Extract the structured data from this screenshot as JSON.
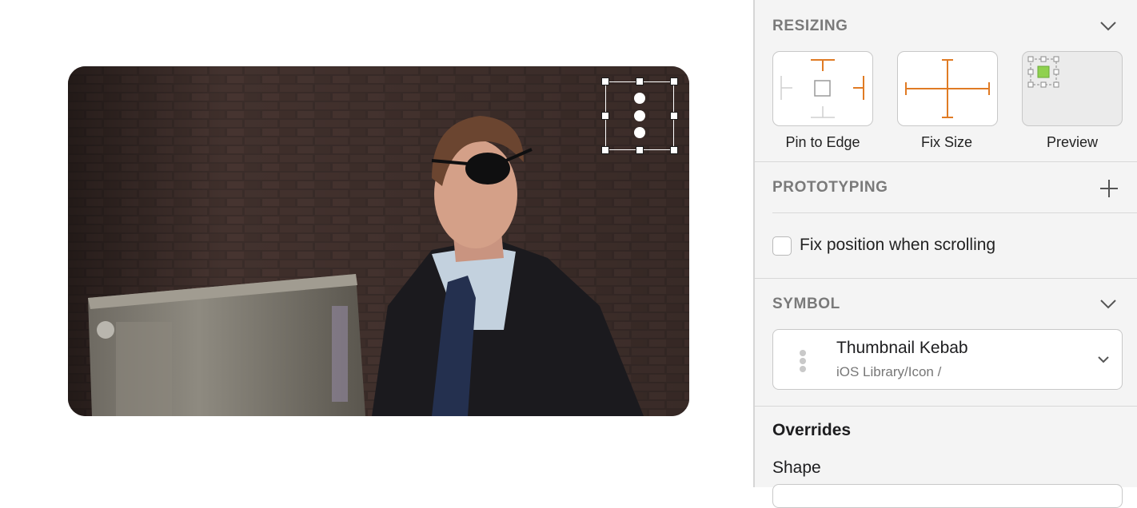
{
  "canvas": {
    "thumbnail": {
      "image_subject": "photo-man-with-eye-patch-in-alley"
    },
    "overlay_icon": "kebab-icon"
  },
  "inspector": {
    "resizing": {
      "title": "RESIZING",
      "options": [
        {
          "label": "Pin to Edge",
          "icon": "pin-to-edge-icon"
        },
        {
          "label": "Fix Size",
          "icon": "fix-size-icon"
        },
        {
          "label": "Preview",
          "icon": "preview-icon"
        }
      ]
    },
    "prototyping": {
      "title": "PROTOTYPING",
      "fix_position_label": "Fix position when scrolling",
      "fix_position_checked": false
    },
    "symbol": {
      "title": "SYMBOL",
      "name": "Thumbnail Kebab",
      "path": "iOS Library/Icon /"
    },
    "overrides": {
      "title": "Overrides",
      "shape_label": "Shape"
    }
  },
  "colors": {
    "accent_orange": "#e07b24",
    "preview_green": "#8fd14f",
    "section_header": "#7a7a7a",
    "panel_bg": "#f4f4f4"
  }
}
